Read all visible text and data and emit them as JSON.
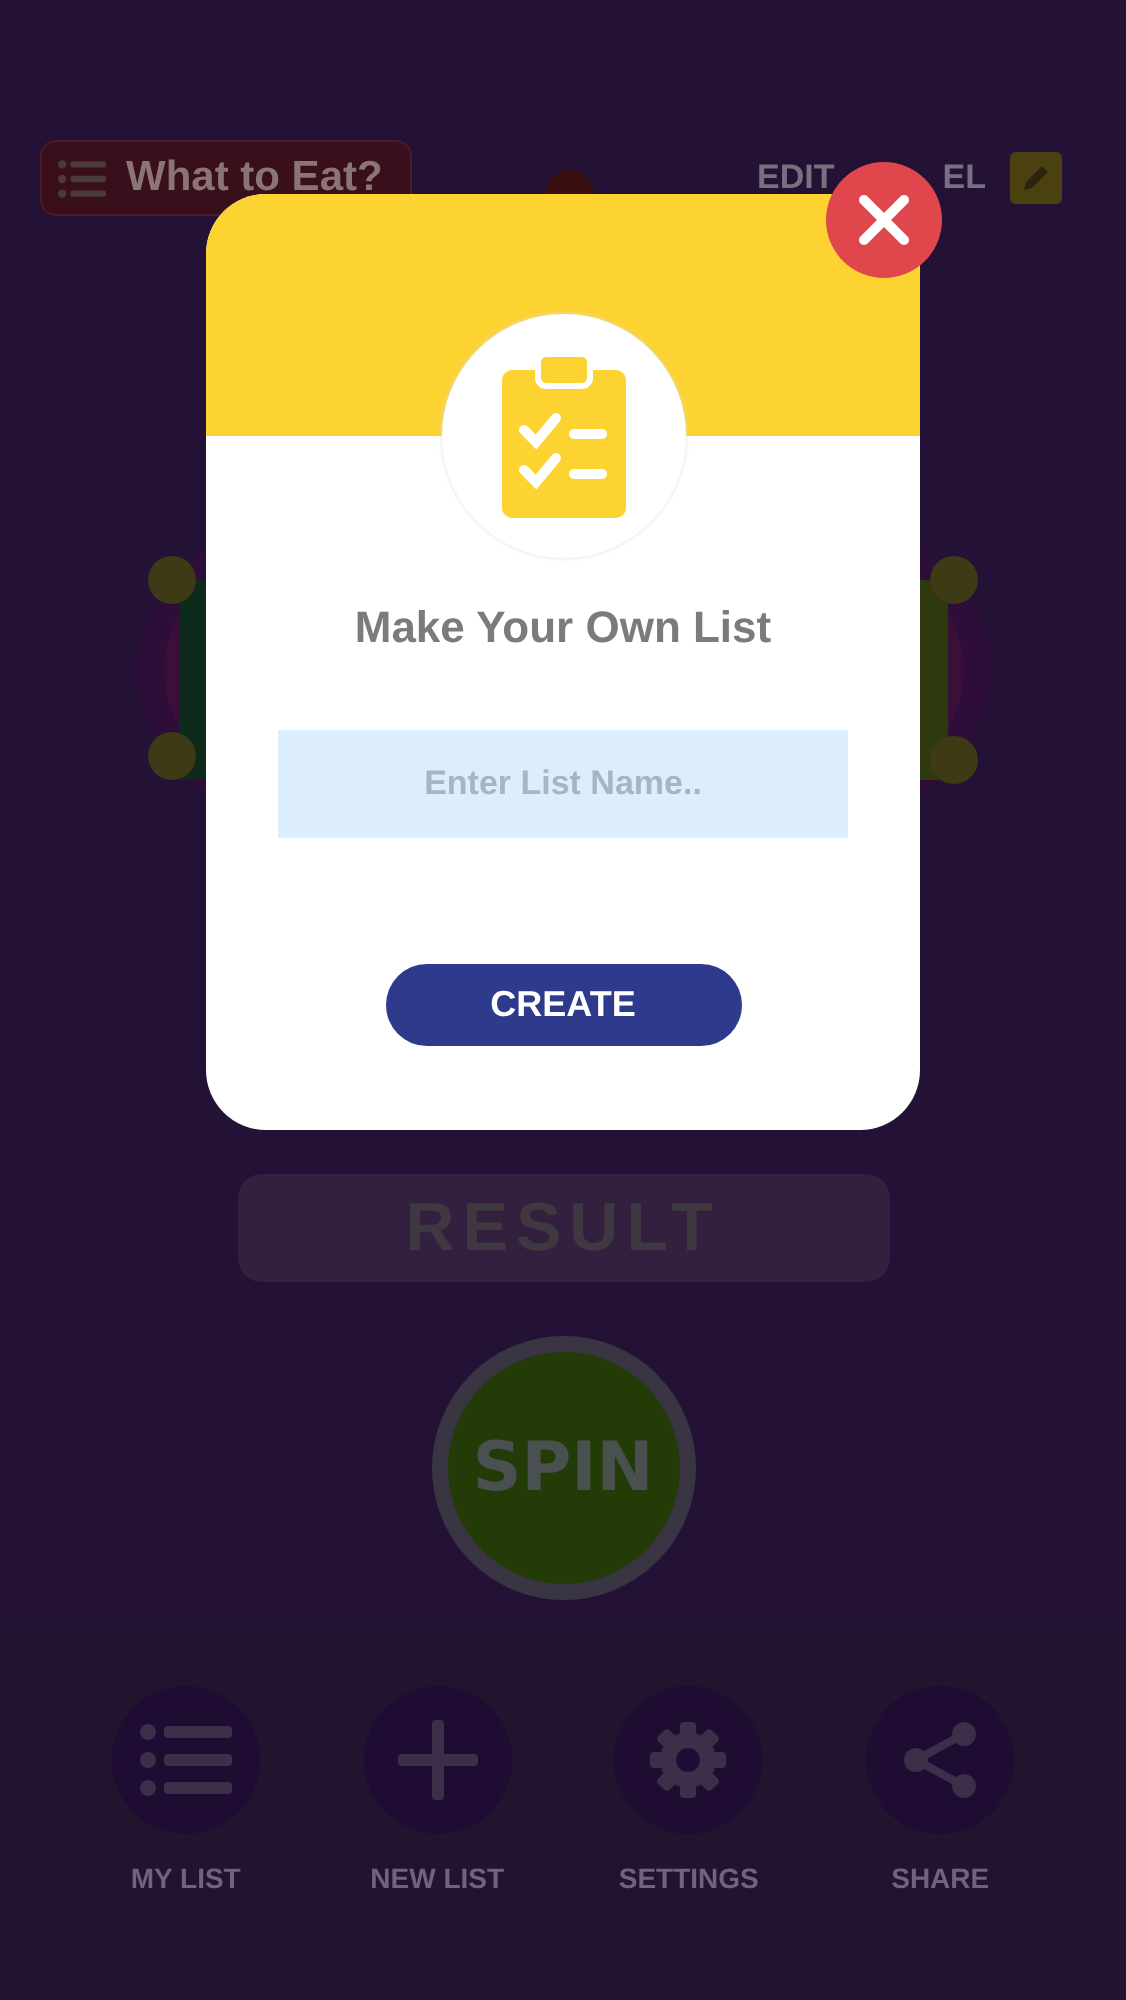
{
  "header": {
    "title": "What to Eat?",
    "edit_label": [
      "EDIT",
      "EL"
    ]
  },
  "result": {
    "label": "RESULT"
  },
  "spin": {
    "label": "SPIN"
  },
  "nav": [
    {
      "kind": "list",
      "label": "MY LIST"
    },
    {
      "kind": "plus",
      "label": "NEW LIST"
    },
    {
      "kind": "gear",
      "label": "SETTINGS"
    },
    {
      "kind": "share",
      "label": "SHARE"
    }
  ],
  "dialog": {
    "title": "Make Your Own List",
    "input": {
      "placeholder": "Enter List Name.."
    },
    "button": "CREATE"
  }
}
